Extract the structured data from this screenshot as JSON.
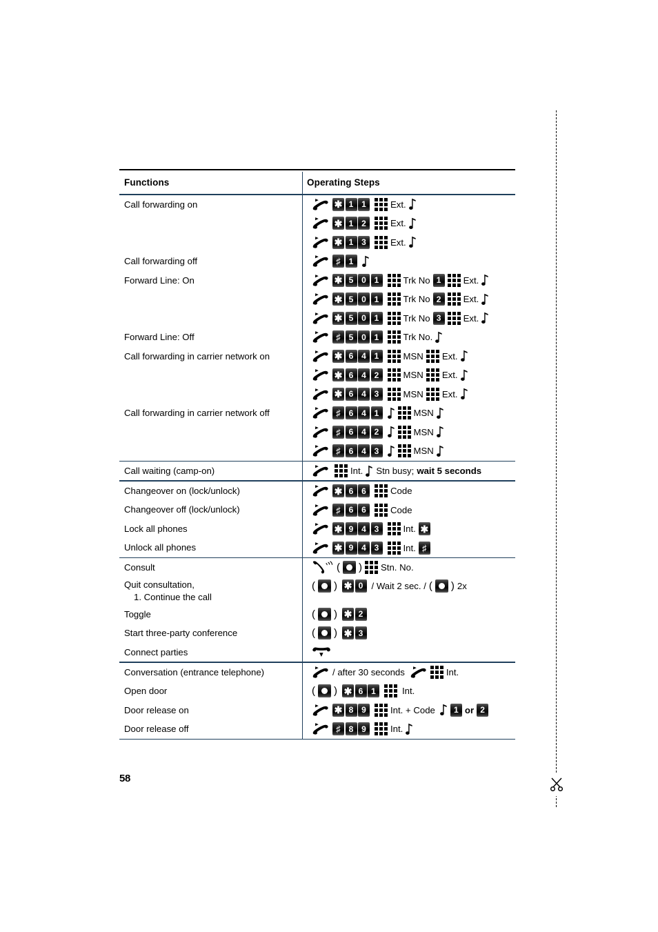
{
  "page": {
    "number": "58"
  },
  "table": {
    "headers": {
      "functions": "Functions",
      "operating_steps": "Operating Steps"
    },
    "groups": [
      {
        "rows": [
          {
            "function": "Call forwarding on",
            "keys": [
              "*",
              "1",
              "1"
            ],
            "after": "Ext."
          },
          {
            "function": "",
            "keys": [
              "*",
              "1",
              "2"
            ],
            "after": "Ext."
          },
          {
            "function": "",
            "keys": [
              "*",
              "1",
              "3"
            ],
            "after": "Ext."
          },
          {
            "function": "Call forwarding off",
            "keys": [
              "#",
              "1"
            ],
            "after": ""
          },
          {
            "function": "Forward Line: On",
            "keys": [
              "*",
              "5",
              "0",
              "1"
            ],
            "mid": "Trk No",
            "badge": "1",
            "after": "Ext."
          },
          {
            "function": "",
            "keys": [
              "*",
              "5",
              "0",
              "1"
            ],
            "mid": "Trk No",
            "badge": "2",
            "after": "Ext."
          },
          {
            "function": "",
            "keys": [
              "*",
              "5",
              "0",
              "1"
            ],
            "mid": "Trk No",
            "badge": "3",
            "after": "Ext."
          },
          {
            "function": "Forward Line: Off",
            "keys": [
              "#",
              "5",
              "0",
              "1"
            ],
            "mid": "Trk No.",
            "after": ""
          },
          {
            "function": "Call forwarding in carrier network on",
            "keys": [
              "*",
              "6",
              "4",
              "1"
            ],
            "mid": "MSN",
            "after": "Ext."
          },
          {
            "function": "",
            "keys": [
              "*",
              "6",
              "4",
              "2"
            ],
            "mid": "MSN",
            "after": "Ext."
          },
          {
            "function": "",
            "keys": [
              "*",
              "6",
              "4",
              "3"
            ],
            "mid": "MSN",
            "after": "Ext."
          },
          {
            "function": "Call forwarding in carrier network off",
            "keys": [
              "#",
              "6",
              "4",
              "1"
            ],
            "after": "MSN"
          },
          {
            "function": "",
            "keys": [
              "#",
              "6",
              "4",
              "2"
            ],
            "after": "MSN"
          },
          {
            "function": "",
            "keys": [
              "#",
              "6",
              "4",
              "3"
            ],
            "after": "MSN"
          }
        ]
      },
      {
        "rows": [
          {
            "function": "Call waiting (camp-on)",
            "int_label": "Int.",
            "tail": "Stn busy;",
            "tail_bold": "wait 5 seconds"
          }
        ]
      },
      {
        "rows": [
          {
            "function": "Changeover on (lock/unlock)",
            "keys": [
              "*",
              "6",
              "6"
            ],
            "after": "Code"
          },
          {
            "function": "Changeover off (lock/unlock)",
            "keys": [
              "#",
              "6",
              "6"
            ],
            "after": "Code"
          },
          {
            "function": "Lock all phones",
            "keys": [
              "*",
              "9",
              "4",
              "3"
            ],
            "after": "Int.",
            "endkey": "*"
          },
          {
            "function": "Unlock all phones",
            "keys": [
              "*",
              "9",
              "4",
              "3"
            ],
            "after": "Int.",
            "endkey": "#"
          }
        ]
      },
      {
        "rows": [
          {
            "function": "Consult",
            "after": "Stn. No."
          },
          {
            "function": "Quit consultation,",
            "function2": "1. Continue the call",
            "keys": [
              "*",
              "0"
            ],
            "mid": "/ Wait 2 sec. /",
            "tail": "2x"
          },
          {
            "function": "Toggle",
            "keys": [
              "*",
              "2"
            ]
          },
          {
            "function": "Start three-party conference",
            "keys": [
              "*",
              "3"
            ]
          },
          {
            "function": "Connect parties"
          }
        ]
      },
      {
        "rows": [
          {
            "function": "Conversation (entrance telephone)",
            "mid": "/ after 30 seconds",
            "after": "Int."
          },
          {
            "function": "Open door",
            "keys": [
              "*",
              "6",
              "1"
            ],
            "after": "Int."
          },
          {
            "function": "Door release on",
            "keys": [
              "*",
              "8",
              "9"
            ],
            "after": "Int. + Code",
            "badge_a": "1",
            "or_label": "or",
            "badge_b": "2"
          },
          {
            "function": "Door release off",
            "keys": [
              "#",
              "8",
              "9"
            ],
            "after": "Int."
          }
        ]
      }
    ]
  },
  "icons": {
    "handset_offhook": "handset-offhook-icon",
    "handset_onhook": "handset-onhook-icon",
    "handset_wave": "handset-wave-icon",
    "keypad": "keypad-icon",
    "note": "tone-note-icon",
    "flash_key": "flash-key-icon",
    "scissors": "scissors-icon"
  },
  "colors": {
    "rule": "#1f3f5c",
    "key_dark": "#0a0a0a",
    "text": "#000000"
  }
}
